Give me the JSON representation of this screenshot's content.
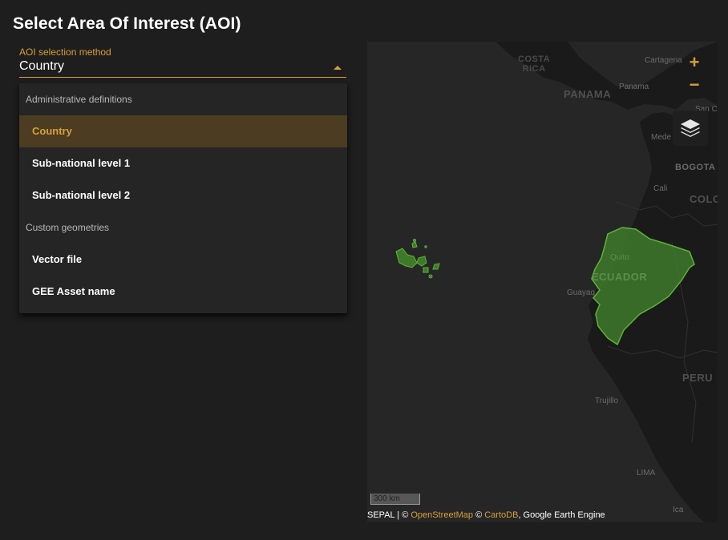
{
  "page": {
    "title": "Select Area Of Interest (AOI)"
  },
  "aoi_select": {
    "label": "AOI selection method",
    "value": "Country"
  },
  "menu": {
    "groups": [
      {
        "header": "Administrative definitions",
        "items": [
          {
            "label": "Country",
            "selected": true
          },
          {
            "label": "Sub-national level 1"
          },
          {
            "label": "Sub-national level 2"
          }
        ]
      },
      {
        "header": "Custom geometries",
        "items": [
          {
            "label": "Vector file"
          },
          {
            "label": "GEE Asset name"
          }
        ]
      }
    ]
  },
  "map": {
    "labels": {
      "costa_rica": "COSTA\nRICA",
      "panama_country": "PANAMA",
      "panama_city": "Panama",
      "cartagena": "Cartagena",
      "san": "San C",
      "medellin": "Mede",
      "bogota": "BOGOTA",
      "cali": "Cali",
      "colombia": "COLO",
      "quito": "Quito",
      "ecuador": "ECUADOR",
      "guayaquil": "Guayaq",
      "peru": "PERU",
      "trujillo": "Trujillo",
      "lima": "LIMA",
      "ica": "Ica"
    },
    "zoom_in": "+",
    "zoom_out": "−",
    "scale": "300 km",
    "attribution": {
      "prefix": "SEPAL | © ",
      "osm": "OpenStreetMap",
      "mid": " © ",
      "carto": "CartoDB",
      "suffix": ", Google Earth Engine"
    },
    "colors": {
      "aoi_fill": "#3d7a2a",
      "aoi_stroke": "#5fb33a",
      "land": "#1a1a1a",
      "sea": "#262626"
    }
  }
}
